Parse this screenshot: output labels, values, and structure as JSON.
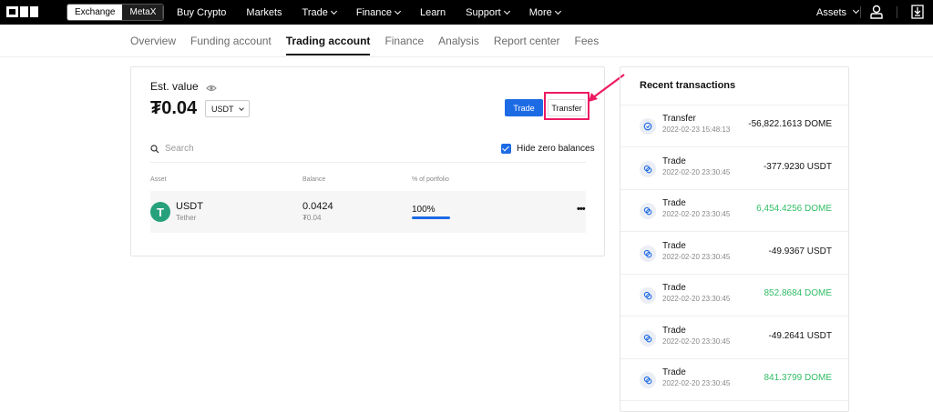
{
  "topbar": {
    "segment": [
      "Exchange",
      "MetaX"
    ],
    "nav": [
      {
        "label": "Buy Crypto",
        "dropdown": false
      },
      {
        "label": "Markets",
        "dropdown": false
      },
      {
        "label": "Trade",
        "dropdown": true
      },
      {
        "label": "Finance",
        "dropdown": true
      },
      {
        "label": "Learn",
        "dropdown": false
      },
      {
        "label": "Support",
        "dropdown": true
      },
      {
        "label": "More",
        "dropdown": true
      }
    ],
    "assets_label": "Assets"
  },
  "subnav": [
    "Overview",
    "Funding account",
    "Trading account",
    "Finance",
    "Analysis",
    "Report center",
    "Fees"
  ],
  "subnav_active": "Trading account",
  "account": {
    "est_label": "Est. value",
    "balance": "₮0.04",
    "currency": "USDT",
    "trade_button": "Trade",
    "transfer_button": "Transfer",
    "search_placeholder": "Search",
    "hide_zero_label": "Hide zero balances",
    "columns": [
      "Asset",
      "Balance",
      "% of portfolio"
    ],
    "asset_row": {
      "symbol": "USDT",
      "name": "Tether",
      "amount": "0.0424",
      "value": "₮0.04",
      "percent": "100%",
      "percent_fraction": 1.0
    }
  },
  "recent": {
    "title": "Recent transactions",
    "items": [
      {
        "type": "Transfer",
        "time": "2022-02-23 15:48:13",
        "amount": "-56,822.1613 DOME",
        "positive": false
      },
      {
        "type": "Trade",
        "time": "2022-02-20 23:30:45",
        "amount": "-377.9230 USDT",
        "positive": false
      },
      {
        "type": "Trade",
        "time": "2022-02-20 23:30:45",
        "amount": "6,454.4256 DOME",
        "positive": true
      },
      {
        "type": "Trade",
        "time": "2022-02-20 23:30:45",
        "amount": "-49.9367 USDT",
        "positive": false
      },
      {
        "type": "Trade",
        "time": "2022-02-20 23:30:45",
        "amount": "852.8684 DOME",
        "positive": true
      },
      {
        "type": "Trade",
        "time": "2022-02-20 23:30:45",
        "amount": "-49.2641 USDT",
        "positive": false
      },
      {
        "type": "Trade",
        "time": "2022-02-20 23:30:45",
        "amount": "841.3799 DOME",
        "positive": true
      }
    ]
  },
  "colors": {
    "accent": "#1d6ae5",
    "highlight": "#ee1a64",
    "positive": "#31bd65",
    "tether": "#26a17b"
  }
}
